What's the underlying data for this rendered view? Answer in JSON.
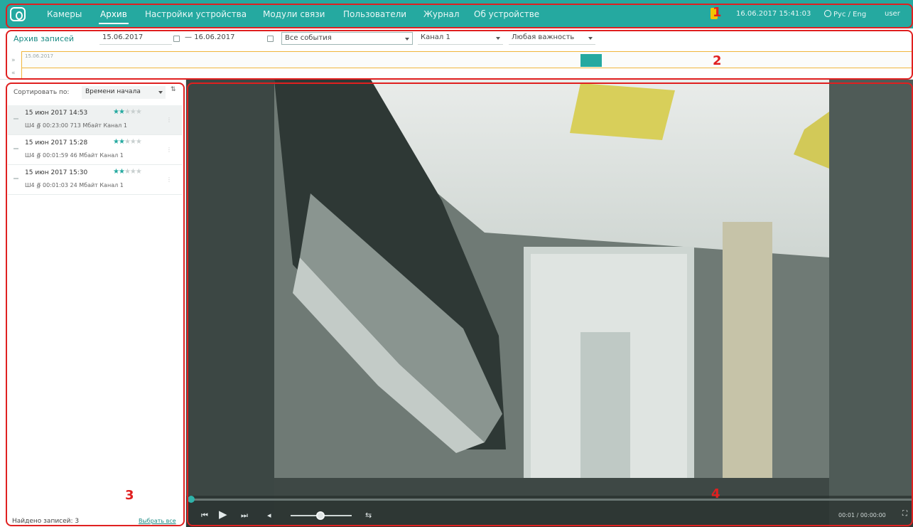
{
  "nav": {
    "items": [
      {
        "label": "Камеры",
        "active": false
      },
      {
        "label": "Архив",
        "active": true
      },
      {
        "label": "Настройки устройства",
        "active": false
      },
      {
        "label": "Модули связи",
        "active": false
      },
      {
        "label": "Пользователи",
        "active": false
      },
      {
        "label": "Журнал",
        "active": false
      },
      {
        "label": "Об устройстве",
        "active": false
      }
    ],
    "datetime": "16.06.2017  15:41:03",
    "lang": "Рус / Eng",
    "user": "user"
  },
  "filter": {
    "title": "Архив записей",
    "date_from": "15.06.2017",
    "date_sep": "—",
    "date_to": "16.06.2017",
    "event_type": "Все события",
    "channel": "Канал 1",
    "importance": "Любая важность",
    "timeline_date": "15.06.2017"
  },
  "list": {
    "sort_label": "Сортировать по:",
    "sort_value": "Времени начала",
    "records": [
      {
        "date": "15 июн 2017 14:53",
        "rating": 2,
        "meta": "Ш4  ∯  00:23:00   713 Мбайт   Канал 1"
      },
      {
        "date": "15 июн 2017 15:28",
        "rating": 2,
        "meta": "Ш4  ∯  00:01:59   46 Мбайт   Канал 1"
      },
      {
        "date": "15 июн 2017 15:30",
        "rating": 2,
        "meta": "Ш4  ∯  00:01:03   24 Мбайт   Канал 1"
      }
    ],
    "footer_count": "Найдено записей: 3",
    "footer_link": "Выбрать все"
  },
  "player": {
    "time": "00:01 / 00:00:00",
    "progress": 0.0,
    "volume": 0.5
  },
  "annotations": [
    "1",
    "2",
    "3",
    "4"
  ],
  "colors": {
    "accent": "#25a9a0",
    "annotation": "#e02020",
    "timeline_border": "#f0b63c"
  }
}
